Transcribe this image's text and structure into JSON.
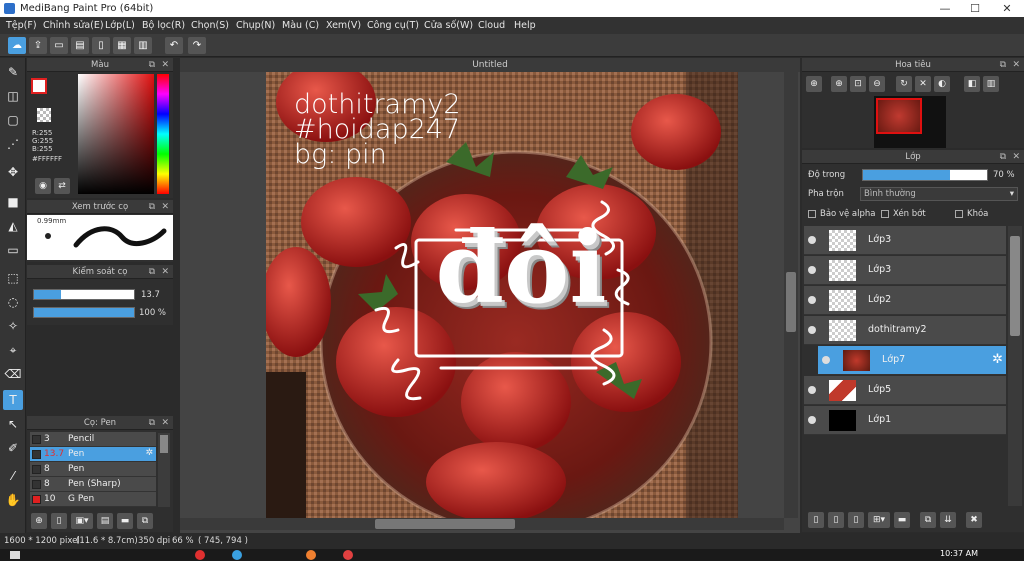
{
  "window": {
    "title": "MediBang Paint Pro (64bit)",
    "minimize": "—",
    "maximize": "☐",
    "close": "✕"
  },
  "menu": [
    "Tệp(F)",
    "Chỉnh sửa(E)",
    "Lớp(L)",
    "Bộ lọc(R)",
    "Chọn(S)",
    "Chụp(N)",
    "Màu (C)",
    "Xem(V)",
    "Công cụ(T)",
    "Cửa số(W)",
    "Cloud",
    "Help"
  ],
  "color_panel": {
    "title": "Màu",
    "r": "R:255",
    "g": "G:255",
    "b": "B:255",
    "hex": "#FFFFFF"
  },
  "brush_preview": {
    "title": "Xem trước cọ",
    "size": "0.99mm"
  },
  "brush_control": {
    "title": "Kiểm soát cọ",
    "size_value": "13.7",
    "opacity_value": "100 %",
    "size_fraction": 0.27,
    "opacity_fraction": 1.0
  },
  "brush_list": {
    "title": "Cọ: Pen",
    "items": [
      {
        "size": "3",
        "name": "Pencil",
        "color": "#333333",
        "selected": false
      },
      {
        "size": "13.7",
        "name": "Pen",
        "color": "#333333",
        "selected": true
      },
      {
        "size": "8",
        "name": "Pen",
        "color": "#333333",
        "selected": false
      },
      {
        "size": "8",
        "name": "Pen (Sharp)",
        "color": "#333333",
        "selected": false
      },
      {
        "size": "10",
        "name": "G Pen",
        "color": "#e02020",
        "selected": false
      }
    ]
  },
  "canvas": {
    "tab": "Untitled",
    "text_lines": [
      "dothitramy2",
      "#hoidap247",
      "bg: pin"
    ],
    "center_word": "đôi"
  },
  "navigator": {
    "title": "Hoa tiêu"
  },
  "layers": {
    "title": "Lớp",
    "opacity_label": "Độ trong",
    "opacity_value": "70 %",
    "opacity_fraction": 0.7,
    "blend_label": "Pha trộn",
    "blend_value": "Bình thường",
    "protect_alpha": "Bảo vệ alpha",
    "clipping": "Xén bớt",
    "lock": "Khóa",
    "items": [
      {
        "name": "Lớp3",
        "selected": false,
        "thumb": "checker"
      },
      {
        "name": "Lớp3",
        "selected": false,
        "thumb": "checker"
      },
      {
        "name": "Lớp2",
        "selected": false,
        "thumb": "checker"
      },
      {
        "name": "dothitramy2",
        "selected": false,
        "thumb": "checker"
      },
      {
        "name": "Lớp7",
        "selected": true,
        "thumb": "photo"
      },
      {
        "name": "Lớp5",
        "selected": false,
        "thumb": "photo2"
      },
      {
        "name": "Lớp1",
        "selected": false,
        "thumb": "black"
      }
    ]
  },
  "status": {
    "size": "1600 * 1200 pixel",
    "cm": "(11.6 * 8.7cm)",
    "dpi": "350 dpi",
    "zoom": "66 %",
    "coords": "( 745, 794 )"
  },
  "taskbar": {
    "time": "10:37 AM"
  },
  "colors": {
    "accent": "#4a9fe0",
    "panel": "#2f2f2f"
  }
}
